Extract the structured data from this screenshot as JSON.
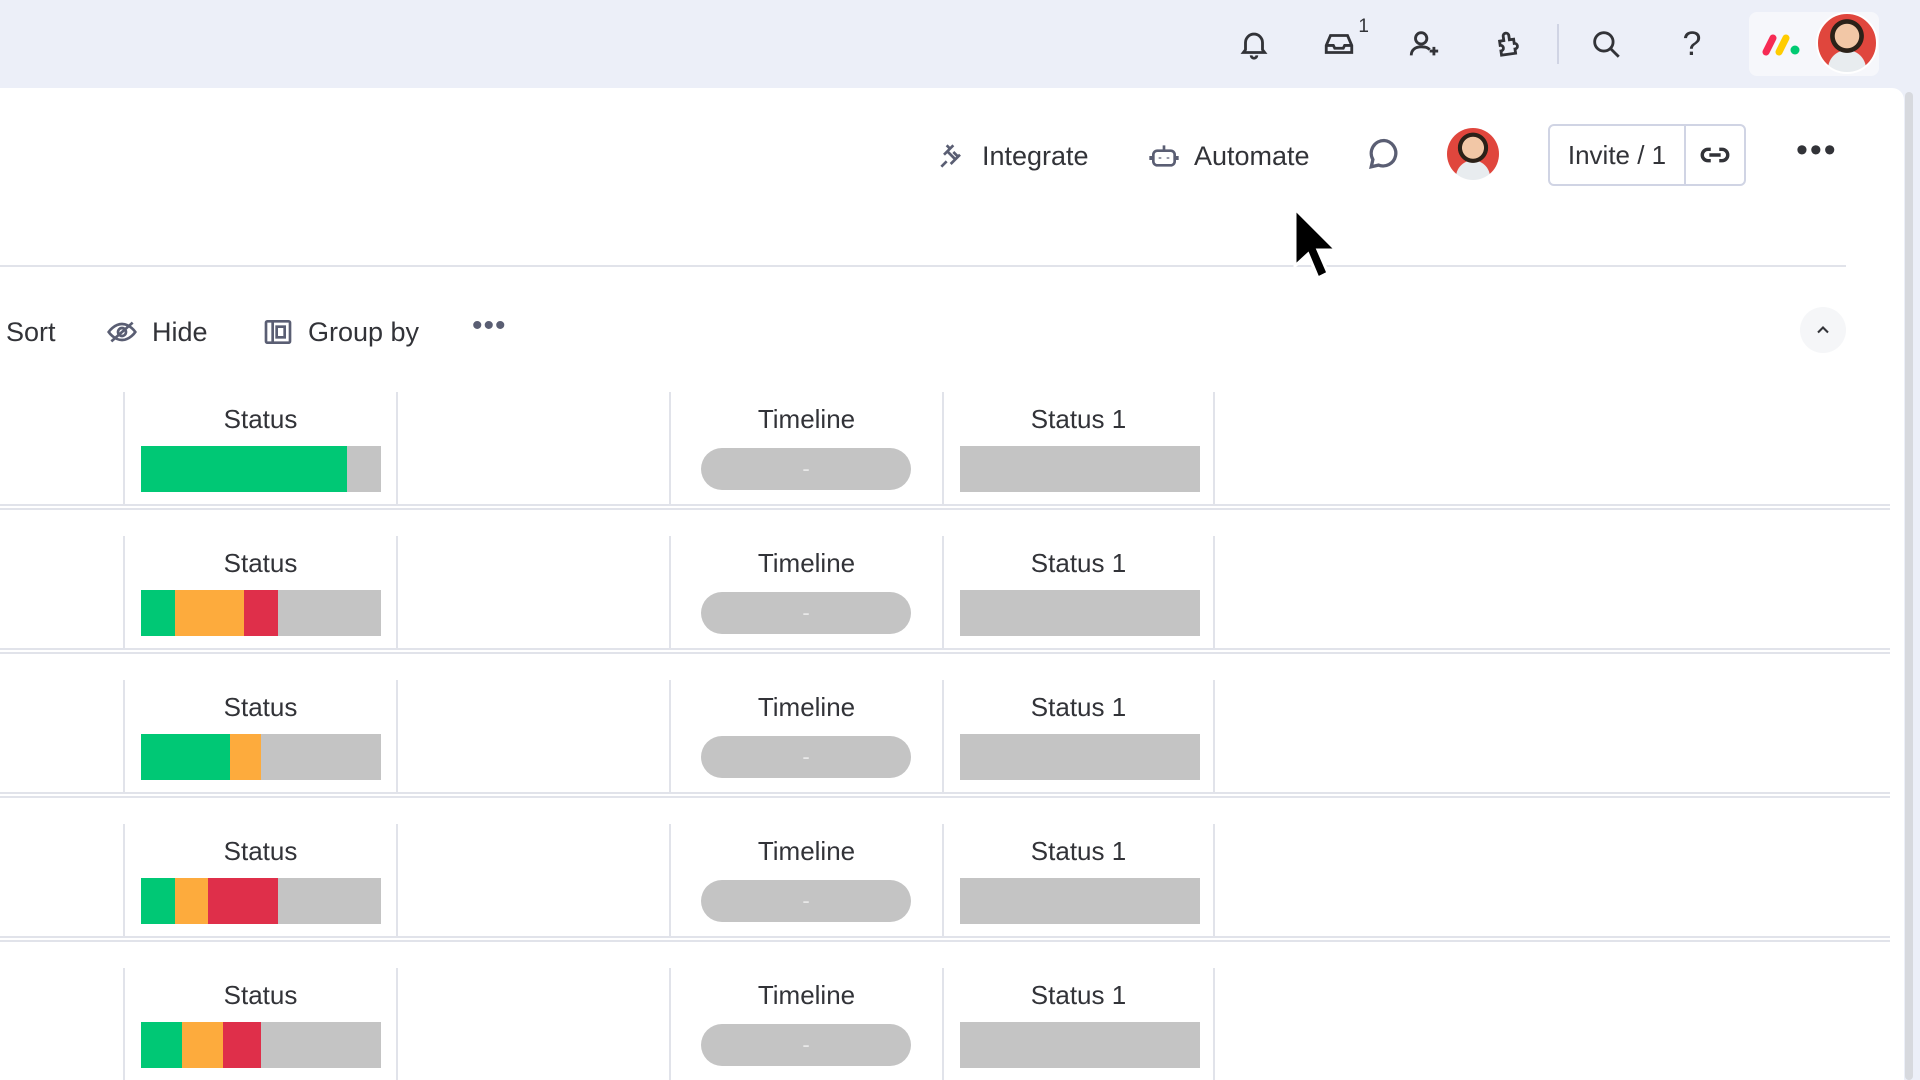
{
  "topbar": {
    "icons": [
      "bell-icon",
      "inbox-icon",
      "invite-members-icon",
      "apps-icon",
      "search-icon",
      "help-icon"
    ],
    "inbox_badge": "1",
    "help_label": "?"
  },
  "header": {
    "integrate_label": "Integrate",
    "automate_label": "Automate",
    "invite_label": "Invite / 1"
  },
  "toolbar": {
    "sort_label": "Sort",
    "hide_label": "Hide",
    "group_by_label": "Group by",
    "more_label": "•••"
  },
  "columns": {
    "status": "Status",
    "timeline": "Timeline",
    "status1": "Status 1",
    "timeline_empty": "-"
  },
  "colors": {
    "done": "#00c875",
    "working": "#fdab3d",
    "stuck": "#df2f4a",
    "empty": "#c4c4c4"
  },
  "groups": [
    {
      "summary": [
        {
          "status": "done",
          "fraction": 0.86
        }
      ]
    },
    {
      "summary": [
        {
          "status": "done",
          "fraction": 0.14
        },
        {
          "status": "working",
          "fraction": 0.29
        },
        {
          "status": "stuck",
          "fraction": 0.14
        }
      ]
    },
    {
      "summary": [
        {
          "status": "done",
          "fraction": 0.37
        },
        {
          "status": "working",
          "fraction": 0.13
        }
      ]
    },
    {
      "summary": [
        {
          "status": "done",
          "fraction": 0.14
        },
        {
          "status": "working",
          "fraction": 0.14
        },
        {
          "status": "stuck",
          "fraction": 0.29
        }
      ]
    },
    {
      "summary": [
        {
          "status": "done",
          "fraction": 0.17
        },
        {
          "status": "working",
          "fraction": 0.17
        },
        {
          "status": "stuck",
          "fraction": 0.16
        }
      ]
    }
  ]
}
